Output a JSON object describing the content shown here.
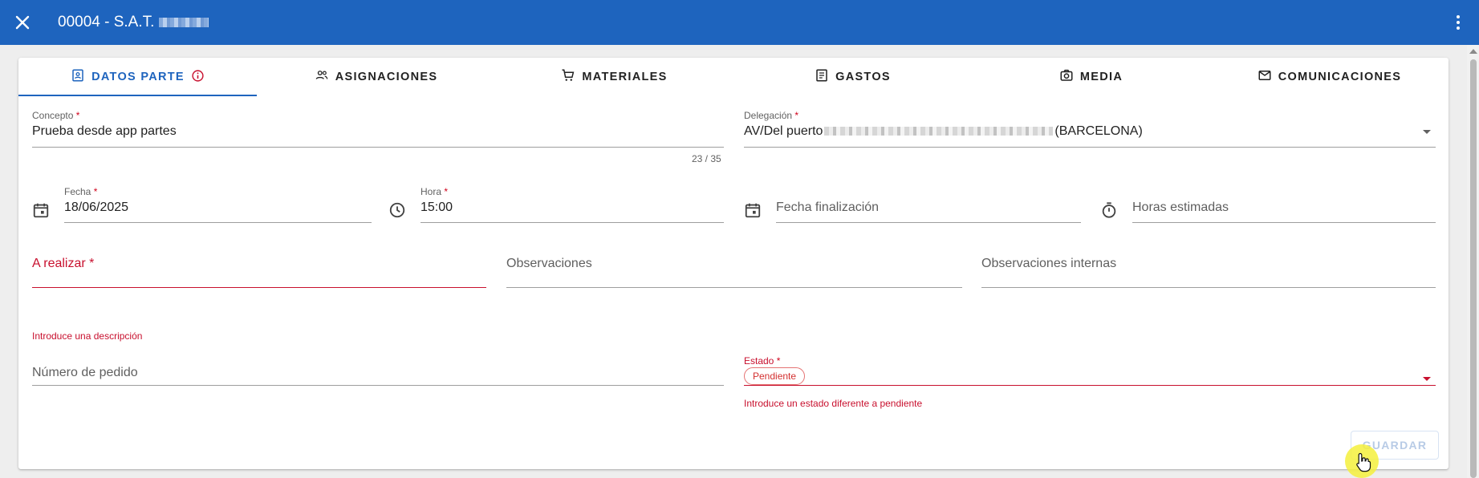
{
  "header": {
    "title": "00004 - S.A.T.",
    "close_icon": "close-icon",
    "menu_icon": "more-vert-icon",
    "bg_color": "#1e64be"
  },
  "tabs": [
    {
      "label": "DATOS PARTE",
      "icon": "contact-card-icon",
      "active": true
    },
    {
      "label": "ASIGNACIONES",
      "icon": "people-icon",
      "active": false
    },
    {
      "label": "MATERIALES",
      "icon": "cart-icon",
      "active": false
    },
    {
      "label": "GASTOS",
      "icon": "receipt-icon",
      "active": false
    },
    {
      "label": "MEDIA",
      "icon": "camera-icon",
      "active": false
    },
    {
      "label": "COMUNICACIONES",
      "icon": "mail-icon",
      "active": false
    }
  ],
  "form": {
    "concepto": {
      "label": "Concepto",
      "required": "*",
      "value": "Prueba desde app partes",
      "counter": "23 / 35"
    },
    "delegacion": {
      "label": "Delegación",
      "required": "*",
      "value_start": "AV/Del puerto",
      "value_end": "(BARCELONA)"
    },
    "fecha": {
      "label": "Fecha",
      "required": "*",
      "value": "18/06/2025"
    },
    "hora": {
      "label": "Hora",
      "required": "*",
      "value": "15:00"
    },
    "fecha_fin": {
      "placeholder": "Fecha finalización"
    },
    "horas_estimadas": {
      "placeholder": "Horas estimadas"
    },
    "a_realizar": {
      "placeholder": "A realizar *",
      "error": "Introduce una descripción"
    },
    "observaciones": {
      "placeholder": "Observaciones"
    },
    "observaciones_internas": {
      "placeholder": "Observaciones internas"
    },
    "numero_pedido": {
      "placeholder": "Número de pedido"
    },
    "estado": {
      "label": "Estado",
      "required": "*",
      "chip": "Pendiente",
      "error": "Introduce un estado diferente a pendiente"
    }
  },
  "actions": {
    "save_label": "GUARDAR"
  },
  "colors": {
    "primary": "#1e64be",
    "error": "#c8102e"
  }
}
